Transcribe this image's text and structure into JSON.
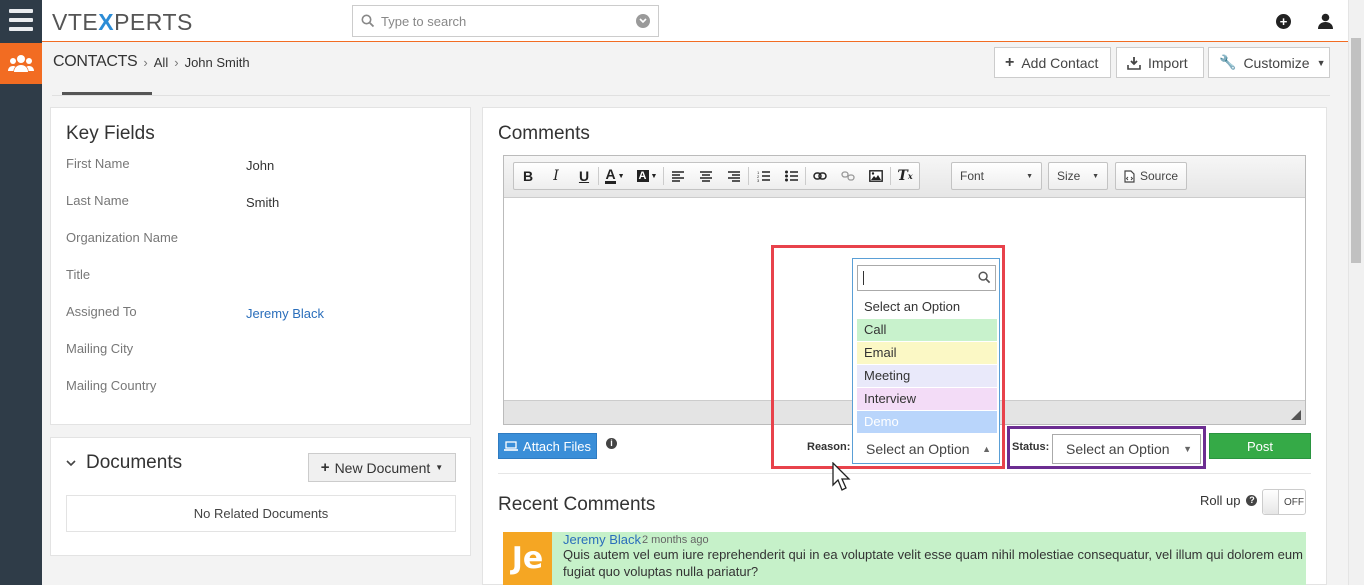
{
  "app": {
    "logo_left": "VTE",
    "logo_x": "X",
    "logo_right": "PERTS"
  },
  "search": {
    "placeholder": "Type to search"
  },
  "breadcrumb": {
    "module": "CONTACTS",
    "filter": "All",
    "record": "John Smith"
  },
  "header_buttons": {
    "add_contact": "Add Contact",
    "import": "Import",
    "customize": "Customize"
  },
  "key_fields": {
    "title": "Key Fields",
    "fields": [
      {
        "label": "First Name",
        "value": "John"
      },
      {
        "label": "Last Name",
        "value": "Smith"
      },
      {
        "label": "Organization Name",
        "value": ""
      },
      {
        "label": "Title",
        "value": ""
      },
      {
        "label": "Assigned To",
        "value": "Jeremy Black"
      },
      {
        "label": "Mailing City",
        "value": ""
      },
      {
        "label": "Mailing Country",
        "value": ""
      }
    ]
  },
  "documents": {
    "title": "Documents",
    "new_button": "New Document",
    "empty": "No Related Documents"
  },
  "comments": {
    "title": "Comments",
    "toolbar": {
      "font": "Font",
      "size": "Size",
      "source": "Source"
    },
    "attach_label": "Attach Files",
    "reason_label": "Reason:",
    "reason_value": "Select an Option",
    "reason_options": [
      {
        "label": "Select an Option",
        "color": "#ffffff"
      },
      {
        "label": "Call",
        "color": "#c8f2cc"
      },
      {
        "label": "Email",
        "color": "#fbf8c5"
      },
      {
        "label": "Meeting",
        "color": "#e9e9fa"
      },
      {
        "label": "Interview",
        "color": "#f3dcf7"
      },
      {
        "label": "Demo",
        "color": "#b9d5fb"
      }
    ],
    "status_label": "Status:",
    "status_value": "Select an Option",
    "post_label": "Post"
  },
  "recent": {
    "title": "Recent Comments",
    "rollup_label": "Roll up",
    "rollup_state": "OFF",
    "items": [
      {
        "avatar": "Je",
        "author": "Jeremy Black",
        "time": "2 months ago",
        "text": "Quis autem vel eum iure reprehenderit qui in ea voluptate velit esse quam nihil molestiae consequatur, vel illum qui dolorem eum fugiat quo voluptas nulla pariatur?"
      }
    ]
  },
  "colors": {
    "accent": "#f26c22",
    "rail": "#2f3c48",
    "primary": "#3a8ed8",
    "success": "#35aa47",
    "reason_highlight": "#e8424b",
    "status_highlight": "#6c2d91"
  }
}
